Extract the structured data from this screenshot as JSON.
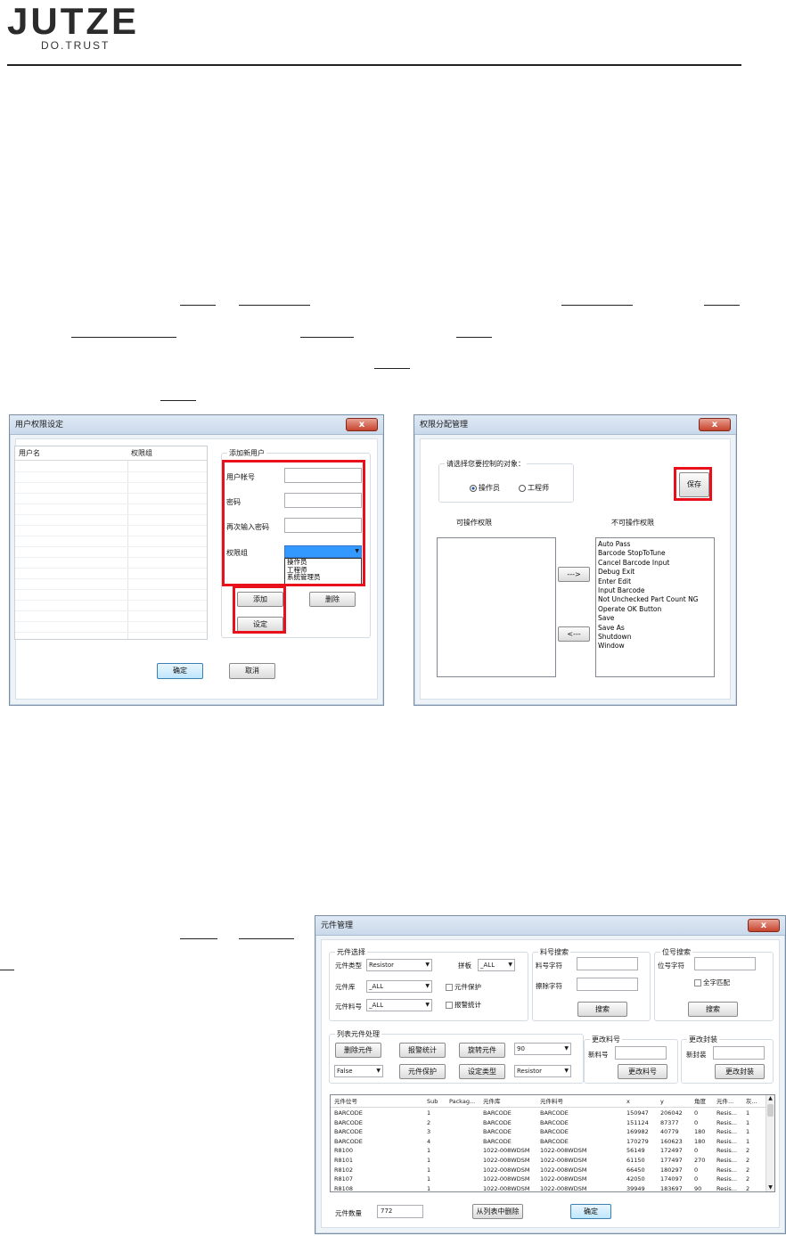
{
  "logo": {
    "main": "JUTZE",
    "sub": "DO.TRUST"
  },
  "dialog_user": {
    "title": "用户权限设定",
    "close": "x",
    "table_headers": [
      "用户名",
      "权限组"
    ],
    "group_title": "添加新用户",
    "fields": {
      "account": "用户帐号",
      "password": "密码",
      "confirm": "再次输入密码",
      "group": "权限组"
    },
    "dropdown_options": [
      "操作员",
      "工程师",
      "系统管理员"
    ],
    "buttons": {
      "add": "添加",
      "delete": "删除",
      "set": "设定",
      "ok": "确定",
      "cancel": "取消"
    }
  },
  "dialog_perm": {
    "title": "权限分配管理",
    "close": "x",
    "group_title": "请选择您要控制的对象：",
    "radio_operator": "操作员",
    "radio_engineer": "工程师",
    "save": "保存",
    "allowed_label": "可操作权限",
    "denied_label": "不可操作权限",
    "move_right": "--->",
    "move_left": "<---",
    "denied_items": [
      "Auto Pass",
      "Barcode StopToTune",
      "Cancel Barcode Input",
      "Debug Exit",
      "Enter Edit",
      "Input Barcode",
      "Not Unchecked Part Count NG",
      "Operate OK Button",
      "Save",
      "Save As",
      "Shutdown",
      "Window"
    ]
  },
  "dialog_comp": {
    "title": "元件管理",
    "close": "x",
    "sel_group": "元件选择",
    "type_label": "元件类型",
    "type_value": "Resistor",
    "panel_label": "拼板",
    "panel_value": "_ALL",
    "lib_label": "元件库",
    "lib_value": "_ALL",
    "protect_label": "元件保护",
    "part_label": "元件料号",
    "part_value": "_ALL",
    "alarm_label": "报警统计",
    "pn_group": "料号搜索",
    "pn_char": "料号字符",
    "pn_erase": "擦除字符",
    "pn_search": "搜索",
    "pos_group": "位号搜索",
    "pos_char": "位号字符",
    "full_match": "全字匹配",
    "pos_search": "搜索",
    "list_group": "列表元件处理",
    "btn_delete": "删除元件",
    "btn_alarm": "报警统计",
    "btn_rotate": "旋转元件",
    "rotate_value": "90",
    "false_value": "False",
    "btn_protect": "元件保护",
    "btn_settype": "设定类型",
    "settype_value": "Resistor",
    "chg_pn_group": "更改料号",
    "new_pn": "新料号",
    "btn_chg_pn": "更改料号",
    "chg_pkg_group": "更改封装",
    "new_pkg": "新封装",
    "btn_chg_pkg": "更改封装",
    "headers": [
      "元件位号",
      "Sub",
      "Packag...",
      "元件库",
      "元件料号",
      "x",
      "y",
      "角度",
      "元件...",
      "灰..."
    ],
    "rows": [
      [
        "BARCODE",
        "1",
        "",
        "BARCODE",
        "BARCODE",
        "150947",
        "206042",
        "0",
        "Resis...",
        "1"
      ],
      [
        "BARCODE",
        "2",
        "",
        "BARCODE",
        "BARCODE",
        "151124",
        "87377",
        "0",
        "Resis...",
        "1"
      ],
      [
        "BARCODE",
        "3",
        "",
        "BARCODE",
        "BARCODE",
        "169982",
        "40779",
        "180",
        "Resis...",
        "1"
      ],
      [
        "BARCODE",
        "4",
        "",
        "BARCODE",
        "BARCODE",
        "170279",
        "160623",
        "180",
        "Resis...",
        "1"
      ],
      [
        "R8100",
        "1",
        "",
        "1022-008WDSM",
        "1022-008WDSM",
        "56149",
        "172497",
        "0",
        "Resis...",
        "2"
      ],
      [
        "R8101",
        "1",
        "",
        "1022-008WDSM",
        "1022-008WDSM",
        "61150",
        "177497",
        "270",
        "Resis...",
        "2"
      ],
      [
        "R8102",
        "1",
        "",
        "1022-008WDSM",
        "1022-008WDSM",
        "66450",
        "180297",
        "0",
        "Resis...",
        "2"
      ],
      [
        "R8107",
        "1",
        "",
        "1022-008WDSM",
        "1022-008WDSM",
        "42050",
        "174097",
        "0",
        "Resis...",
        "2"
      ],
      [
        "R8108",
        "1",
        "",
        "1022-008WDSM",
        "1022-008WDSM",
        "39949",
        "183697",
        "90",
        "Resis...",
        "2"
      ]
    ],
    "count_label": "元件数量",
    "count_value": "772",
    "btn_remove": "从列表中删除",
    "btn_ok": "确定"
  }
}
